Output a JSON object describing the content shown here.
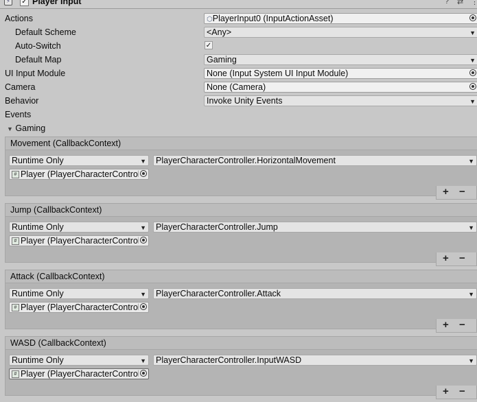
{
  "header": {
    "title": "Player Input"
  },
  "fields": {
    "actions": {
      "label": "Actions",
      "value": "PlayerInput0 (InputActionAsset)"
    },
    "default_scheme": {
      "label": "Default Scheme",
      "value": "<Any>"
    },
    "auto_switch": {
      "label": "Auto-Switch",
      "checked": "✓"
    },
    "default_map": {
      "label": "Default Map",
      "value": "Gaming"
    },
    "ui_input_module": {
      "label": "UI Input Module",
      "value": "None (Input System UI Input Module)"
    },
    "camera": {
      "label": "Camera",
      "value": "None (Camera)"
    },
    "behavior": {
      "label": "Behavior",
      "value": "Invoke Unity Events"
    }
  },
  "events": {
    "label": "Events",
    "map_label": "Gaming",
    "items": [
      {
        "title": "Movement (CallbackContext)",
        "runtime": "Runtime Only",
        "function": "PlayerCharacterController.HorizontalMovement",
        "object": "Player (PlayerCharacterController)"
      },
      {
        "title": "Jump (CallbackContext)",
        "runtime": "Runtime Only",
        "function": "PlayerCharacterController.Jump",
        "object": "Player (PlayerCharacterController)"
      },
      {
        "title": "Attack (CallbackContext)",
        "runtime": "Runtime Only",
        "function": "PlayerCharacterController.Attack",
        "object": "Player (PlayerCharacterController)"
      },
      {
        "title": "WASD (CallbackContext)",
        "runtime": "Runtime Only",
        "function": "PlayerCharacterController.InputWASD",
        "object": "Player (PlayerCharacterController)"
      }
    ],
    "plus": "+",
    "minus": "−"
  }
}
